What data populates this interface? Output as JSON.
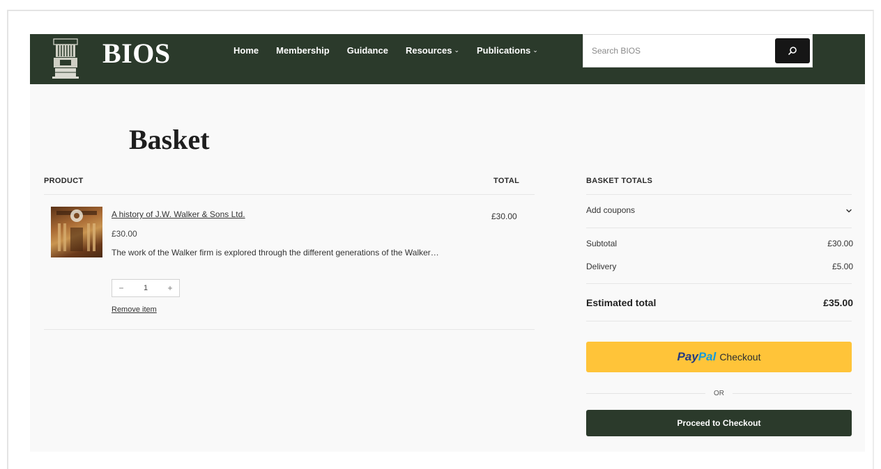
{
  "header": {
    "brand": "BIOS",
    "nav": [
      {
        "label": "Home",
        "has_caret": false
      },
      {
        "label": "Membership",
        "has_caret": false
      },
      {
        "label": "Guidance",
        "has_caret": false
      },
      {
        "label": "Resources",
        "has_caret": true
      },
      {
        "label": "Publications",
        "has_caret": true
      }
    ],
    "caret_glyph": "⌄",
    "search": {
      "placeholder": "Search BIOS",
      "value": "",
      "icon": "search-icon"
    },
    "colors": {
      "header_bg": "#2b3a2b"
    }
  },
  "page": {
    "title": "Basket"
  },
  "cart": {
    "columns": {
      "product": "PRODUCT",
      "total": "TOTAL"
    },
    "items": [
      {
        "name": "A history of J.W. Walker & Sons Ltd.",
        "price": "£30.00",
        "description": "The work of the Walker firm is explored through the different generations of the Walker…",
        "quantity": "1",
        "qty_minus": "−",
        "qty_plus": "+",
        "remove_label": "Remove item",
        "line_total": "£30.00"
      }
    ]
  },
  "totals": {
    "heading": "BASKET TOTALS",
    "coupon_label": "Add coupons",
    "coupon_icon": "chevron-down-icon",
    "subtotal_label": "Subtotal",
    "subtotal_value": "£30.00",
    "delivery_label": "Delivery",
    "delivery_value": "£5.00",
    "estimated_label": "Estimated total",
    "estimated_value": "£35.00"
  },
  "actions": {
    "paypal_pay": "Pay",
    "paypal_pal": "Pal",
    "paypal_text": "Checkout",
    "or_label": "OR",
    "checkout_label": "Proceed to Checkout",
    "colors": {
      "paypal_bg": "#ffc439",
      "checkout_bg": "#2b3a2b"
    }
  }
}
